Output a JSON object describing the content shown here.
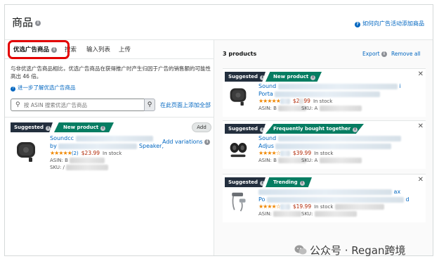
{
  "header": {
    "title": "商品",
    "howto_link": "如何向广告活动添加商品"
  },
  "tabs": [
    {
      "label": "优选广告商品",
      "active": true
    },
    {
      "label": "搜索",
      "active": false
    },
    {
      "label": "输入列表",
      "active": false
    },
    {
      "label": "上传",
      "active": false
    }
  ],
  "left": {
    "description": "与非优选广告商品相比，优选广告商品在获得推广时产生归因于广告的销售额的可能性高出 46 倍。",
    "learn_more": "进一步了解优选广告商品",
    "search_placeholder": "按 ASIN 搜索优选广告商品",
    "add_all_link": "在此页面上添加全部",
    "card": {
      "badges": [
        "Suggested",
        "New product"
      ],
      "title_line1": "Soundcc",
      "title_line2_prefix": "by",
      "title_line2_suffix": "Speaker,",
      "rating_count": "(2)",
      "price": "$23.99",
      "stock": "In stock",
      "asin_label": "ASIN: B",
      "sku_label": "SKU: /",
      "add_button": "Add",
      "add_variations": "Add variations"
    }
  },
  "right": {
    "count": "3 products",
    "export": "Export",
    "remove_all": "Remove all",
    "items": [
      {
        "badges": [
          "Suggested",
          "New product"
        ],
        "title_line1": "Sound",
        "title_line2": "Porta",
        "title_end": "i",
        "rating_count": "",
        "price": "$2",
        "price_end": "99",
        "stock": "In stock",
        "asin_label": "ASIN: B",
        "sku_label": "SKU: A"
      },
      {
        "badges": [
          "Suggested",
          "Frequently bought together"
        ],
        "title_line1": "Sound",
        "title_line2": "Adjus",
        "rating_count": "",
        "price": "$39.99",
        "stock": "In stock",
        "asin_label": "ASIN: B",
        "sku_label": "SKU: A"
      },
      {
        "badges": [
          "Suggested",
          "Trending"
        ],
        "title_line1": "",
        "title_line2": "Po",
        "title_end": "ax",
        "title_end2": "d",
        "rating_count": "",
        "price": "$19.99",
        "stock": "In stock",
        "asin_label": "ASIN:",
        "sku_label": "SKU:"
      }
    ]
  },
  "watermark": "公众号 · Regan跨境",
  "colors": {
    "link": "#0066c0",
    "badge_dark": "#232f3e",
    "badge_green": "#067d62",
    "price": "#b12704",
    "star": "#f08804",
    "highlight_box": "#e30000"
  }
}
